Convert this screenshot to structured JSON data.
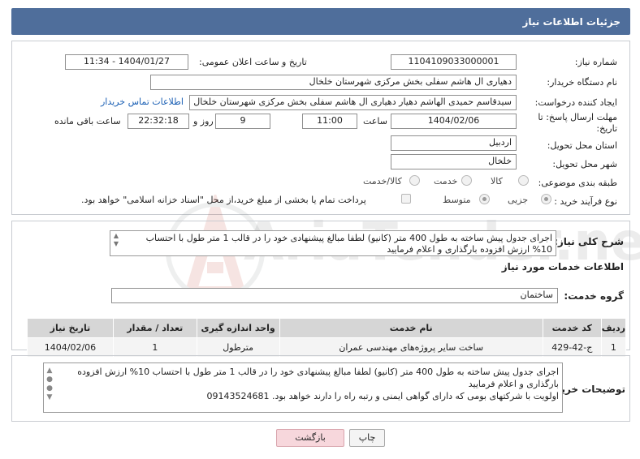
{
  "page_title": "جزئیات اطلاعات نیاز",
  "need_number": {
    "label": "شماره نیاز:",
    "value": "1104109033000001"
  },
  "announce_datetime": {
    "label": "تاریخ و ساعت اعلان عمومی:",
    "value": "1404/01/27 - 11:34"
  },
  "buyer_org": {
    "label": "نام دستگاه خریدار:",
    "value": "دهیاری ال هاشم سفلی بخش مرکزی شهرستان خلخال"
  },
  "requester": {
    "label": "ایجاد کننده درخواست:",
    "value": "سیدقاسم حمیدی الهاشم دهیار دهیاری ال هاشم سفلی بخش مرکزی شهرستان خلخال",
    "contact_link": "اطلاعات تماس خریدار"
  },
  "deadline": {
    "label": "مهلت ارسال پاسخ: تا تاریخ:",
    "date": "1404/02/06",
    "time_label": "ساعت",
    "time": "11:00",
    "days": "9",
    "days_label": "روز و",
    "remaining": "22:32:18",
    "remaining_label": "ساعت باقی مانده"
  },
  "province": {
    "label": "استان محل تحویل:",
    "value": "اردبیل"
  },
  "city": {
    "label": "شهر محل تحویل:",
    "value": "خلخال"
  },
  "category": {
    "label": "طبقه بندی موضوعی:",
    "options": [
      "کالا",
      "خدمت",
      "کالا/خدمت"
    ]
  },
  "purchase_type": {
    "label": "نوع فرآیند خرید :",
    "options": [
      "جزیی",
      "متوسط"
    ],
    "note": "پرداخت تمام یا بخشی از مبلغ خرید،از محل \"اسناد خزانه اسلامی\" خواهد بود."
  },
  "summary": {
    "label": "شرح کلی نیاز:",
    "text": "اجرای جدول پیش ساخته به طول 400 متر (کانیو) لطفا مبالغ پیشنهادی خود  را در قالب 1 متر طول با احتساب 10% ارزش افزوده  بارگذاری و اعلام فرمایید"
  },
  "services_section": {
    "title": "اطلاعات خدمات مورد نیاز",
    "group_label": "گروه خدمت:",
    "group_value": "ساختمان"
  },
  "table": {
    "headers": [
      "ردیف",
      "کد خدمت",
      "نام خدمت",
      "واحد اندازه گیری",
      "تعداد / مقدار",
      "تاریخ نیاز"
    ],
    "rows": [
      [
        "1",
        "ج-42-429",
        "ساخت سایر پروژه‌های مهندسی عمران",
        "مترطول",
        "1",
        "1404/02/06"
      ]
    ]
  },
  "buyer_notes": {
    "label": "توضیحات خریدار:",
    "line1": "اجرای جدول پیش ساخته به طول 400 متر (کانیو) لطفا مبالغ پیشنهادی خود  را در قالب 1 متر طول با احتساب 10% ارزش افزوده  بارگذاری و اعلام فرمایید",
    "line2": "اولویت با شرکتهای بومی  که دارای گواهی ایمنی و رتبه راه را دارند خواهد بود. 09143524681"
  },
  "buttons": {
    "print": "چاپ",
    "back": "بازگشت"
  },
  "watermark_text": "AriaTender.neT",
  "colors": {
    "header": "#4f6e9b",
    "back_button": "#f7d7dc",
    "link": "#1a5fb4"
  }
}
